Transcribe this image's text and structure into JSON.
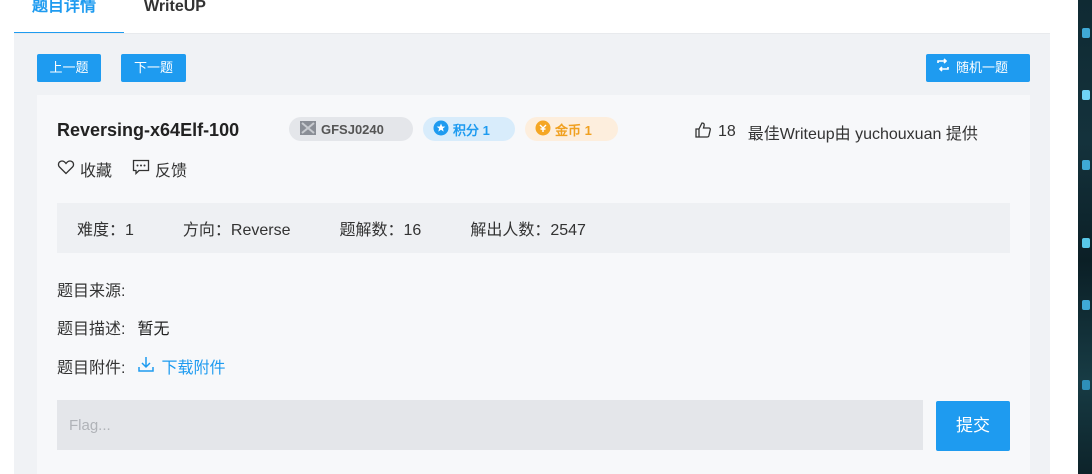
{
  "tabs": [
    {
      "label": "题目详情",
      "active": true
    },
    {
      "label": "WriteUP",
      "active": false
    }
  ],
  "nav": {
    "prev_label": "上一题",
    "next_label": "下一题",
    "random_label": "随机一题"
  },
  "challenge": {
    "title": "Reversing-x64Elf-100",
    "id_badge": "GFSJ0240",
    "score_badge": "积分 1",
    "coin_badge": "金币 1",
    "likes_count": "18",
    "best_writeup": "最佳Writeup由 yuchouxuan 提供",
    "favorite_label": "收藏",
    "feedback_label": "反馈"
  },
  "stats": {
    "difficulty": "难度：1",
    "direction": "方向：Reverse",
    "solves": "题解数：16",
    "solvers": "解出人数：2547"
  },
  "details": {
    "source_label": "题目来源:",
    "desc_label": "题目描述:",
    "desc_value": "暂无",
    "attach_label": "题目附件:",
    "download_label": "下载附件"
  },
  "flag": {
    "placeholder": "Flag...",
    "submit_label": "提交"
  },
  "colors": {
    "accent": "#1e9bf0",
    "panel_bg": "#f0f2f5",
    "coin": "#f0a020"
  }
}
